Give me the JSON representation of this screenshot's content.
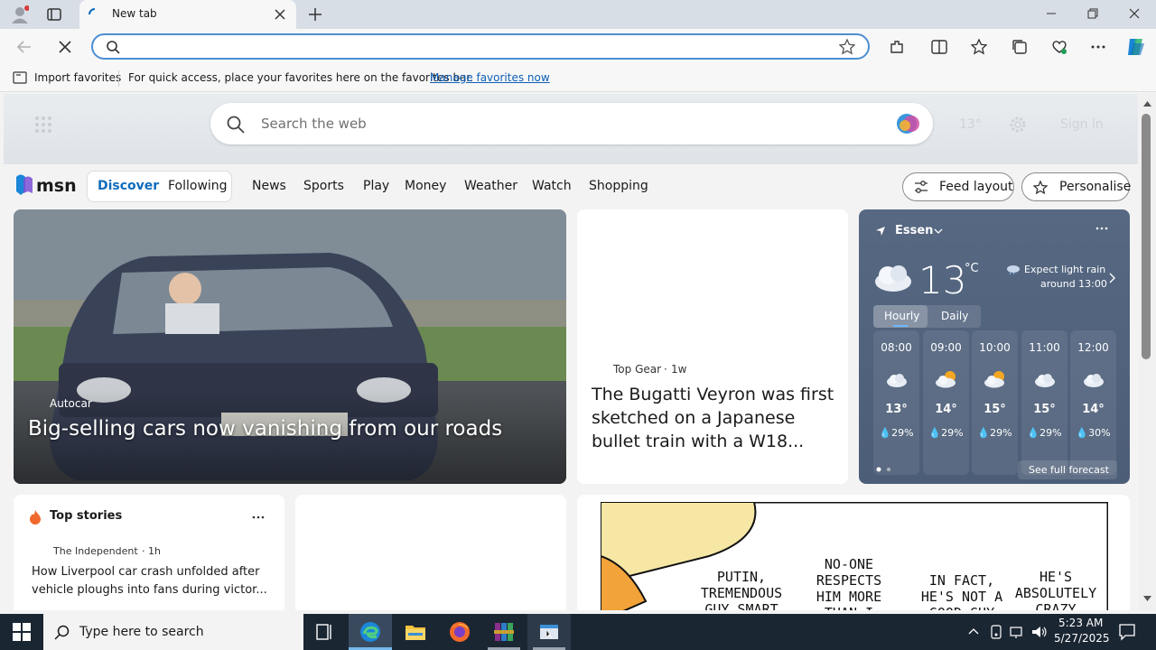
{
  "browser": {
    "tab_title": "New tab",
    "address_value": "",
    "fav_import": "Import favorites",
    "fav_prompt": "For quick access, place your favorites here on the favorites bar.",
    "fav_manage": "Manage favorites now"
  },
  "msn": {
    "search_placeholder": "Search the web",
    "temp_faint": "13°",
    "signin_faint": "Sign in",
    "logo": "msn",
    "nav_seg": [
      "Discover",
      "Following"
    ],
    "nav": [
      "News",
      "Sports",
      "Play",
      "Money",
      "Weather",
      "Watch",
      "Shopping"
    ],
    "feed_layout": "Feed layout",
    "personalise": "Personalise"
  },
  "hero": {
    "source": "Autocar",
    "headline": "Big-selling cars now vanishing from our roads"
  },
  "mid": {
    "source": "Top Gear",
    "age": "1w",
    "headline": "The Bugatti Veyron was first sketched on a Japanese bullet train with a W18..."
  },
  "weather": {
    "location": "Essen",
    "temp": "13",
    "unit": "°C",
    "forecast_line1": "Expect light rain",
    "forecast_line2": "around 13:00",
    "tab_hourly": "Hourly",
    "tab_daily": "Daily",
    "hours": [
      {
        "time": "08:00",
        "temp": "13°",
        "precip": "29%",
        "icon": "cloud-icon"
      },
      {
        "time": "09:00",
        "temp": "14°",
        "precip": "29%",
        "icon": "partly-cloudy-icon"
      },
      {
        "time": "10:00",
        "temp": "15°",
        "precip": "29%",
        "icon": "partly-cloudy-icon"
      },
      {
        "time": "11:00",
        "temp": "15°",
        "precip": "29%",
        "icon": "cloud-icon"
      },
      {
        "time": "12:00",
        "temp": "14°",
        "precip": "30%",
        "icon": "cloud-icon"
      }
    ],
    "see_full": "See full forecast"
  },
  "top_stories": {
    "title": "Top stories",
    "source": "The Independent",
    "age": "1h",
    "headline": "How Liverpool car crash unfolded after vehicle ploughs into fans during victor..."
  },
  "cartoon": {
    "bubble1": "PUTIN, TREMENDOUS GUY SMART",
    "bubble2": "NO-ONE RESPECTS HIM MORE THAN I DO",
    "bubble3": "IN FACT, HE'S NOT A GOOD GUY",
    "bubble4": "HE'S ABSOLUTELY CRAZY"
  },
  "taskbar": {
    "search_placeholder": "Type here to search",
    "time": "5:23 AM",
    "date": "5/27/2025"
  },
  "colors": {
    "accent": "#0f6cbd",
    "weather_bg": "#566882",
    "taskbar": "#1b2633"
  }
}
